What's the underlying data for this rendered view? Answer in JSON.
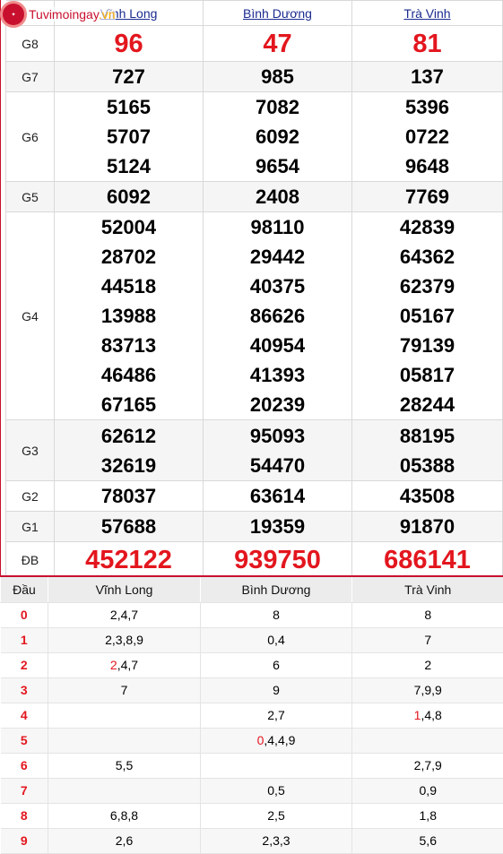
{
  "logo": {
    "site_name": "Tuvimoingay",
    "site_tld": ".vn"
  },
  "provinces": [
    "Vĩnh Long",
    "Bình Dương",
    "Trà Vinh"
  ],
  "prizes": {
    "G8": {
      "label": "G8",
      "values": [
        "96",
        "47",
        "81"
      ]
    },
    "G7": {
      "label": "G7",
      "values": [
        "727",
        "985",
        "137"
      ]
    },
    "G6": {
      "label": "G6",
      "values": [
        [
          "5165",
          "5707",
          "5124"
        ],
        [
          "7082",
          "6092",
          "9654"
        ],
        [
          "5396",
          "0722",
          "9648"
        ]
      ]
    },
    "G5": {
      "label": "G5",
      "values": [
        "6092",
        "2408",
        "7769"
      ]
    },
    "G4": {
      "label": "G4",
      "values": [
        [
          "52004",
          "28702",
          "44518",
          "13988",
          "83713",
          "46486",
          "67165"
        ],
        [
          "98110",
          "29442",
          "40375",
          "86626",
          "40954",
          "41393",
          "20239"
        ],
        [
          "42839",
          "64362",
          "62379",
          "05167",
          "79139",
          "05817",
          "28244"
        ]
      ]
    },
    "G3": {
      "label": "G3",
      "values": [
        [
          "62612",
          "32619"
        ],
        [
          "95093",
          "54470"
        ],
        [
          "88195",
          "05388"
        ]
      ]
    },
    "G2": {
      "label": "G2",
      "values": [
        "78037",
        "63614",
        "43508"
      ]
    },
    "G1": {
      "label": "G1",
      "values": [
        "57688",
        "19359",
        "91870"
      ]
    },
    "DB": {
      "label": "ĐB",
      "values": [
        "452122",
        "939750",
        "686141"
      ]
    }
  },
  "dau_table": {
    "header": {
      "dau": "Đầu",
      "col1": "Vĩnh Long",
      "col2": "Bình Dương",
      "col3": "Trà Vinh"
    },
    "rows": [
      {
        "head": "0",
        "c1": {
          "hl": "",
          "rest": "2,4,7"
        },
        "c2": {
          "hl": "",
          "rest": "8"
        },
        "c3": {
          "hl": "",
          "rest": "8"
        }
      },
      {
        "head": "1",
        "c1": {
          "hl": "",
          "rest": "2,3,8,9"
        },
        "c2": {
          "hl": "",
          "rest": "0,4"
        },
        "c3": {
          "hl": "",
          "rest": "7"
        }
      },
      {
        "head": "2",
        "c1": {
          "hl": "2",
          "rest": ",4,7"
        },
        "c2": {
          "hl": "",
          "rest": "6"
        },
        "c3": {
          "hl": "",
          "rest": "2"
        }
      },
      {
        "head": "3",
        "c1": {
          "hl": "",
          "rest": "7"
        },
        "c2": {
          "hl": "",
          "rest": "9"
        },
        "c3": {
          "hl": "",
          "rest": "7,9,9"
        }
      },
      {
        "head": "4",
        "c1": {
          "hl": "",
          "rest": ""
        },
        "c2": {
          "hl": "",
          "rest": "2,7"
        },
        "c3": {
          "hl": "1",
          "rest": ",4,8"
        }
      },
      {
        "head": "5",
        "c1": {
          "hl": "",
          "rest": ""
        },
        "c2": {
          "hl": "0",
          "rest": ",4,4,9"
        },
        "c3": {
          "hl": "",
          "rest": ""
        }
      },
      {
        "head": "6",
        "c1": {
          "hl": "",
          "rest": "5,5"
        },
        "c2": {
          "hl": "",
          "rest": ""
        },
        "c3": {
          "hl": "",
          "rest": "2,7,9"
        }
      },
      {
        "head": "7",
        "c1": {
          "hl": "",
          "rest": ""
        },
        "c2": {
          "hl": "",
          "rest": "0,5"
        },
        "c3": {
          "hl": "",
          "rest": "0,9"
        }
      },
      {
        "head": "8",
        "c1": {
          "hl": "",
          "rest": "6,8,8"
        },
        "c2": {
          "hl": "",
          "rest": "2,5"
        },
        "c3": {
          "hl": "",
          "rest": "1,8"
        }
      },
      {
        "head": "9",
        "c1": {
          "hl": "",
          "rest": "2,6"
        },
        "c2": {
          "hl": "",
          "rest": "2,3,3"
        },
        "c3": {
          "hl": "",
          "rest": "5,6"
        }
      }
    ]
  },
  "colors": {
    "accent_red": "#e3161e",
    "link_blue": "#1a2b8f",
    "border": "#d9d9d9"
  }
}
